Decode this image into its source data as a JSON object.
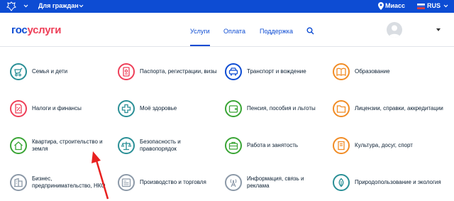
{
  "topbar": {
    "audience": "Для граждан",
    "city": "Миасс",
    "language": "RUS"
  },
  "header": {
    "logo_part1": "гос",
    "logo_part2": "услуги",
    "nav": [
      "Услуги",
      "Оплата",
      "Поддержка"
    ]
  },
  "categories": [
    {
      "label": "Семья и дети",
      "color": "#2a8f96",
      "icon": "stroller-icon"
    },
    {
      "label": "Паспорта, регистрации, визы",
      "color": "#ee3f58",
      "icon": "passport-icon"
    },
    {
      "label": "Транспорт и вождение",
      "color": "#0d4cd3",
      "icon": "car-icon"
    },
    {
      "label": "Образование",
      "color": "#f18c25",
      "icon": "book-icon"
    },
    {
      "label": "Налоги и финансы",
      "color": "#ee3f58",
      "icon": "tax-document-icon"
    },
    {
      "label": "Моё здоровье",
      "color": "#2a8f96",
      "icon": "medical-cross-icon"
    },
    {
      "label": "Пенсия, пособия и льготы",
      "color": "#3aa535",
      "icon": "wallet-icon"
    },
    {
      "label": "Лицензии, справки, аккредитации",
      "color": "#f18c25",
      "icon": "folder-icon"
    },
    {
      "label": "Квартира, строительство и земля",
      "color": "#3aa535",
      "icon": "house-icon"
    },
    {
      "label": "Безопасность и правопорядок",
      "color": "#2a8f96",
      "icon": "scales-icon"
    },
    {
      "label": "Работа и занятость",
      "color": "#3aa535",
      "icon": "briefcase-icon"
    },
    {
      "label": "Культура, досуг, спорт",
      "color": "#f18c25",
      "icon": "ticket-icon"
    },
    {
      "label": "Бизнес, предпринимательство, НКО",
      "color": "#8c99a8",
      "icon": "building-icon"
    },
    {
      "label": "Производство и торговля",
      "color": "#8c99a8",
      "icon": "factory-icon"
    },
    {
      "label": "Информация, связь и реклама",
      "color": "#8c99a8",
      "icon": "antenna-icon"
    },
    {
      "label": "Природопользование и экология",
      "color": "#2a8f96",
      "icon": "leaf-icon"
    }
  ]
}
